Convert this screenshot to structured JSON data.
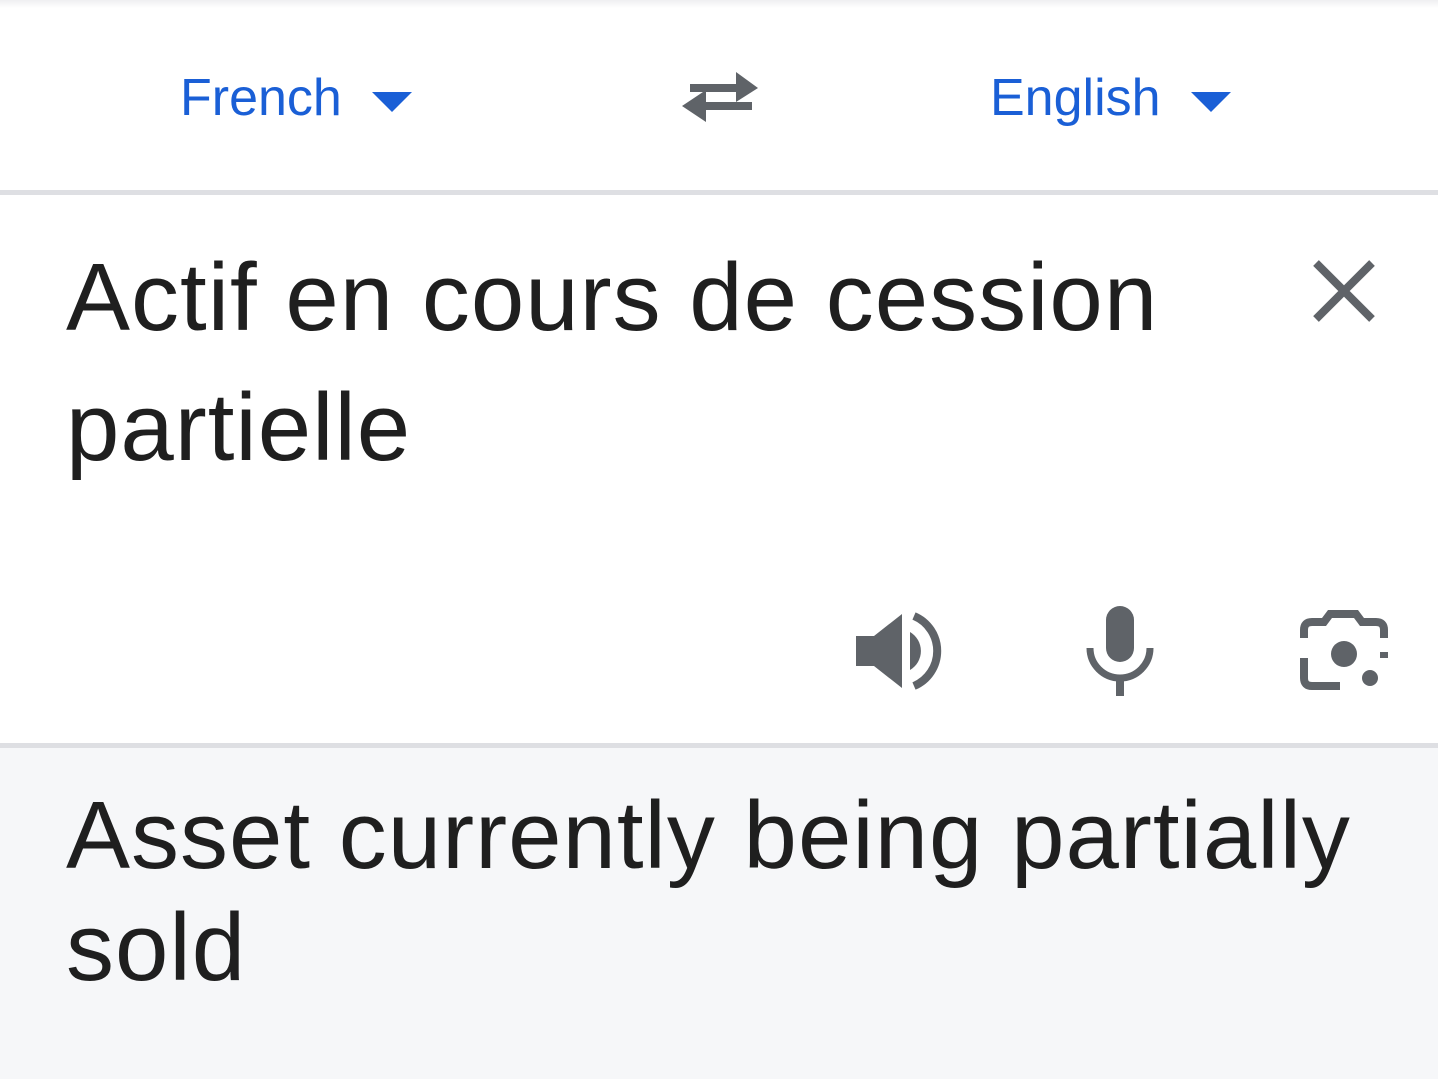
{
  "language_bar": {
    "source_language": "French",
    "target_language": "English",
    "swap_icon": "swap-arrows-icon",
    "dropdown_icon": "caret-down-icon",
    "accent_color": "#1a5fd6"
  },
  "source": {
    "text": "Actif en cours de cession partielle",
    "clear_icon": "close-icon",
    "actions": [
      "speaker-icon",
      "microphone-icon",
      "camera-icon"
    ]
  },
  "result": {
    "text": "Asset currently being partially sold"
  }
}
